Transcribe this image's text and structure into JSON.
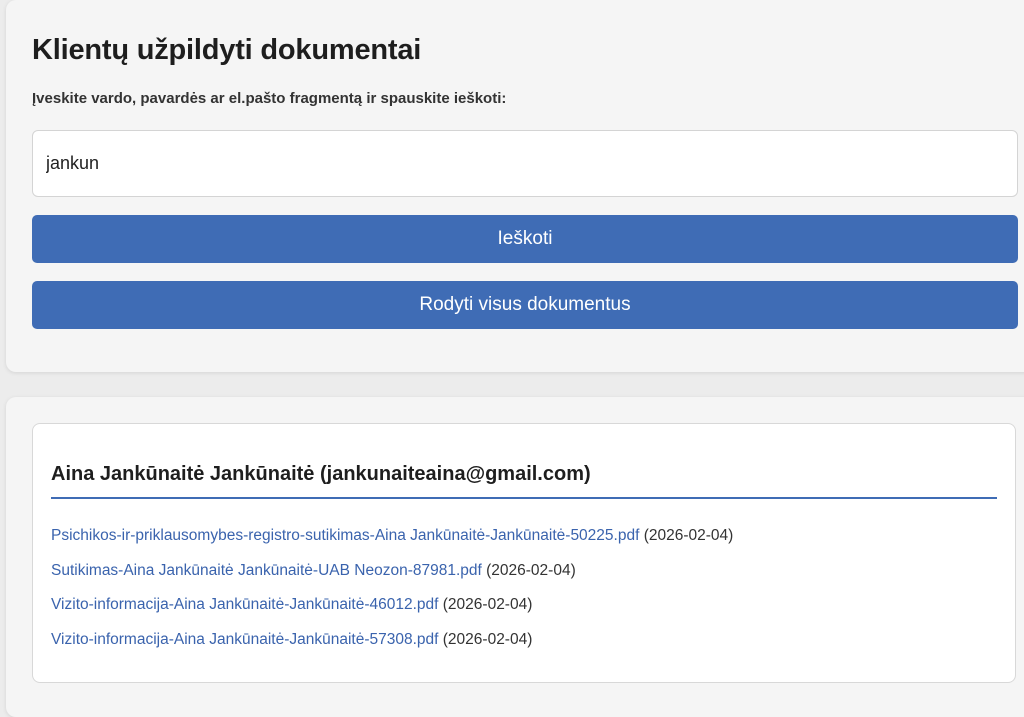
{
  "header": {
    "title": "Klientų užpildyti dokumentai",
    "instructions": "Įveskite vardo, pavardės ar el.pašto fragmentą ir spauskite ieškoti:"
  },
  "search": {
    "value": "jankun",
    "button_label": "Ieškoti",
    "show_all_label": "Rodyti visus dokumentus"
  },
  "results": {
    "client": {
      "name": "Aina Jankūnaitė Jankūnaitė (jankunaiteaina@gmail.com)",
      "documents": [
        {
          "file": "Psichikos-ir-priklausomybes-registro-sutikimas-Aina Jankūnaitė-Jankūnaitė-50225.pdf",
          "date": "(2026-02-04)"
        },
        {
          "file": "Sutikimas-Aina Jankūnaitė Jankūnaitė-UAB Neozon-87981.pdf",
          "date": "(2026-02-04)"
        },
        {
          "file": "Vizito-informacija-Aina Jankūnaitė-Jankūnaitė-46012.pdf",
          "date": "(2026-02-04)"
        },
        {
          "file": "Vizito-informacija-Aina Jankūnaitė-Jankūnaitė-57308.pdf",
          "date": "(2026-02-04)"
        }
      ]
    }
  },
  "colors": {
    "accent": "#3f6cb5",
    "link": "#3a63ad",
    "background": "#ececec",
    "card": "#f5f5f5"
  }
}
